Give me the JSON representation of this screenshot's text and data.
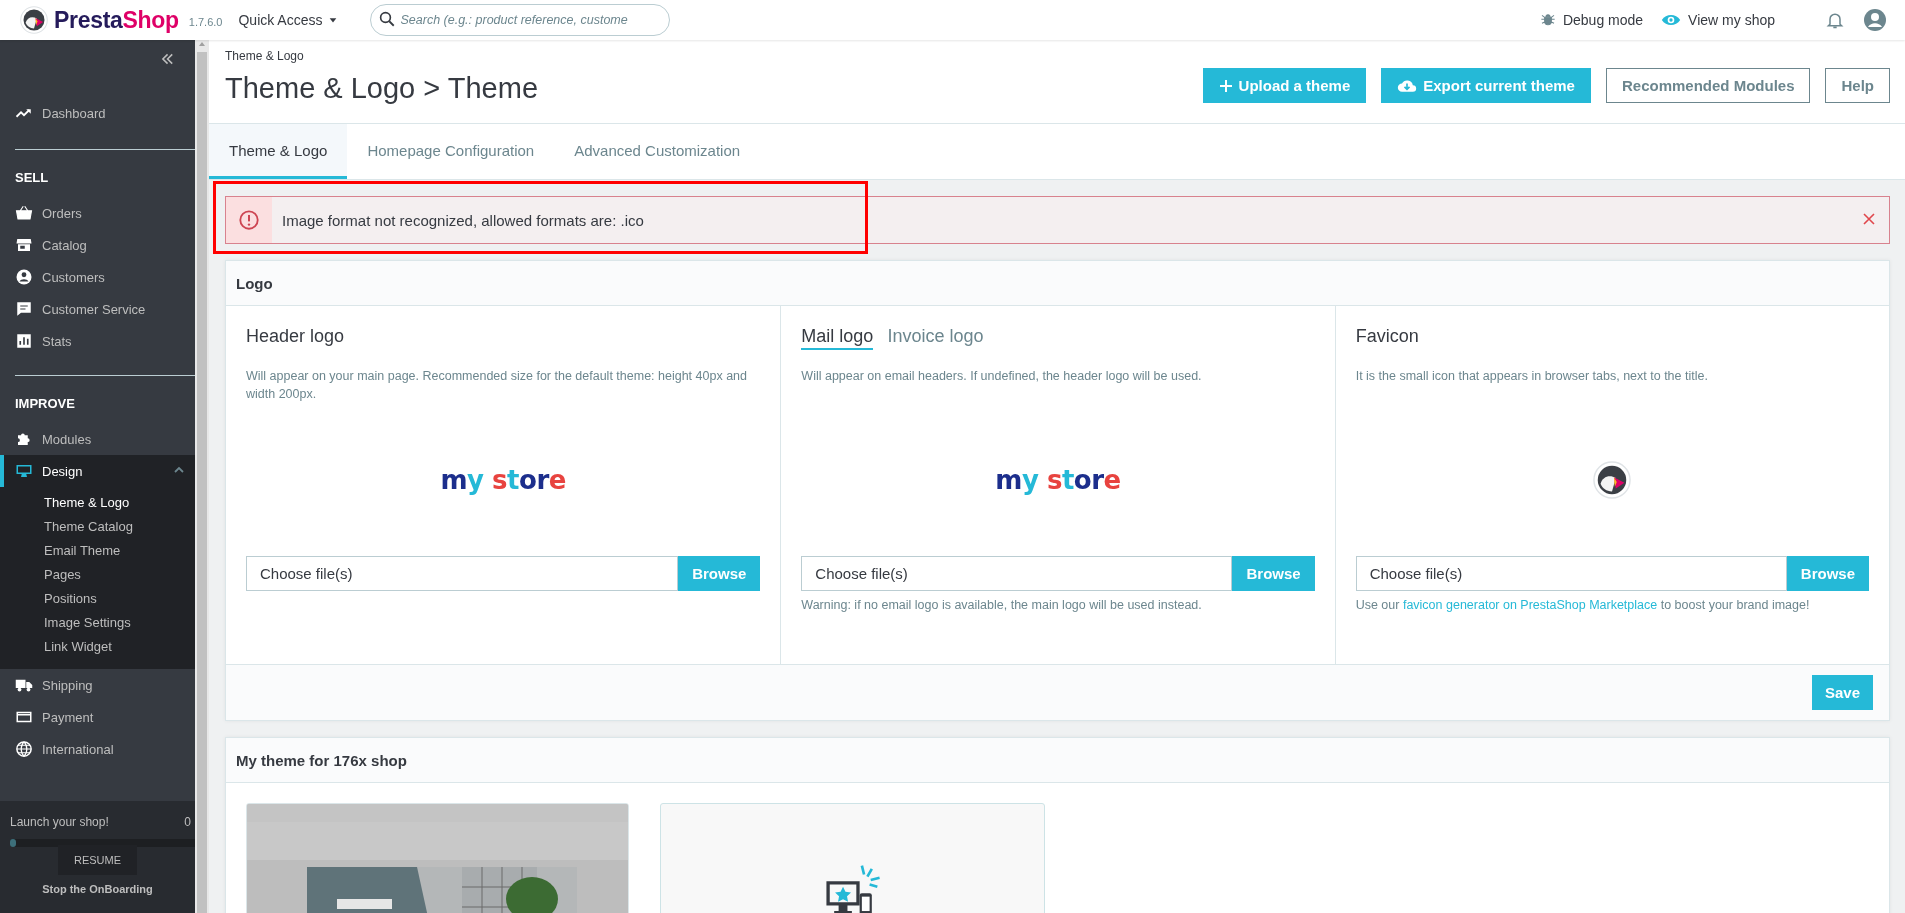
{
  "topbar": {
    "brand": [
      "Presta",
      "Shop"
    ],
    "version": "1.7.6.0",
    "quick_access": "Quick Access",
    "search": {
      "placeholder": "Search (e.g.: product reference, custome"
    },
    "links": [
      "Debug mode",
      "View my shop"
    ]
  },
  "sidebar": {
    "groups": [
      {
        "items": [
          {
            "label": "Dashboard",
            "selected": false,
            "expanded": false
          }
        ]
      },
      {
        "heading": "SELL",
        "items": [
          {
            "label": "Orders",
            "selected": false,
            "expanded": false
          },
          {
            "label": "Catalog",
            "selected": false,
            "expanded": false
          },
          {
            "label": "Customers",
            "selected": false,
            "expanded": false
          },
          {
            "label": "Customer Service",
            "selected": false,
            "expanded": false
          },
          {
            "label": "Stats",
            "selected": false,
            "expanded": false
          }
        ]
      },
      {
        "heading": "IMPROVE",
        "items": [
          {
            "label": "Modules",
            "selected": false,
            "expanded": false
          },
          {
            "label": "Design",
            "selected": true,
            "expanded": true,
            "children": [
              {
                "label": "Theme & Logo",
                "selected": true
              },
              {
                "label": "Theme Catalog",
                "selected": false
              },
              {
                "label": "Email Theme",
                "selected": false
              },
              {
                "label": "Pages",
                "selected": false
              },
              {
                "label": "Positions",
                "selected": false
              },
              {
                "label": "Image Settings",
                "selected": false
              },
              {
                "label": "Link Widget",
                "selected": false
              }
            ]
          },
          {
            "label": "Shipping",
            "selected": false,
            "expanded": false
          },
          {
            "label": "Payment",
            "selected": false,
            "expanded": false
          },
          {
            "label": "International",
            "selected": false,
            "expanded": false
          }
        ]
      }
    ],
    "onboarding": {
      "label": "Launch your shop!",
      "percent": "0",
      "level": 0,
      "button": "RESUME",
      "stop": "Stop the OnBoarding"
    }
  },
  "header": {
    "breadcrumb": "Theme & Logo",
    "title": "Theme & Logo > Theme",
    "buttons": [
      {
        "label": "Upload a theme",
        "kind": "primary"
      },
      {
        "label": "Export current theme",
        "kind": "primary"
      },
      {
        "label": "Recommended Modules",
        "kind": "outline"
      },
      {
        "label": "Help",
        "kind": "outline"
      }
    ]
  },
  "tabs": [
    {
      "label": "Theme & Logo",
      "selected": true
    },
    {
      "label": "Homepage Configuration",
      "selected": false
    },
    {
      "label": "Advanced Customization",
      "selected": false
    }
  ],
  "alert": {
    "message": "Image format not recognized, allowed formats are: .ico",
    "annotation_frame": true
  },
  "logo_panel": {
    "title": "Logo",
    "columns": [
      {
        "tabs": [
          {
            "label": "Header logo",
            "selected": true
          }
        ],
        "description": "Will appear on your main page. Recommended size for the default theme: height 40px and width 200px.",
        "preview": {
          "kind": "logo",
          "text": "my store"
        },
        "file_label": "Choose file(s)",
        "browse": "Browse"
      },
      {
        "tabs": [
          {
            "label": "Mail logo",
            "selected": true
          },
          {
            "label": "Invoice logo",
            "selected": false
          }
        ],
        "description": "Will appear on email headers. If undefined, the header logo will be used.",
        "preview": {
          "kind": "logo",
          "text": "my store"
        },
        "file_label": "Choose file(s)",
        "browse": "Browse",
        "note_parts": [
          {
            "text": "Warning: if no email logo is available, the main logo will be used instead.",
            "link": false
          }
        ]
      },
      {
        "tabs": [
          {
            "label": "Favicon",
            "selected": true
          }
        ],
        "description": "It is the small icon that appears in browser tabs, next to the title.",
        "preview": {
          "kind": "favicon"
        },
        "file_label": "Choose file(s)",
        "browse": "Browse",
        "note_parts": [
          {
            "text": "Use our ",
            "link": false
          },
          {
            "text": "favicon generator on PrestaShop Marketplace",
            "link": true
          },
          {
            "text": " to boost your brand image!",
            "link": false
          }
        ]
      }
    ],
    "save": "Save"
  },
  "theme_panel": {
    "title": "My theme for 176x shop",
    "cards": [
      {
        "kind": "picture"
      },
      {
        "kind": "add"
      }
    ]
  }
}
